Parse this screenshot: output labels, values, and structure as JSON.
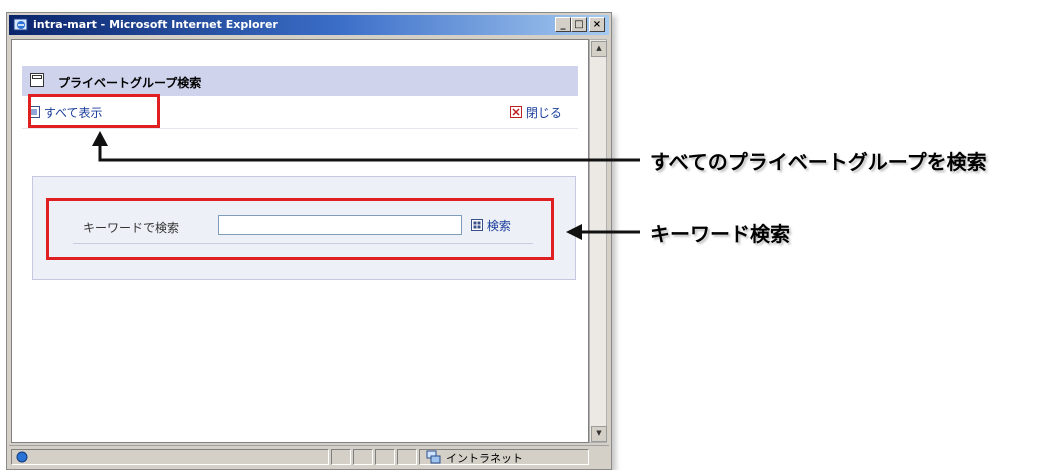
{
  "window": {
    "title": "intra-mart - Microsoft Internet Explorer",
    "min_glyph": "_",
    "max_glyph": "□",
    "close_glyph": "×"
  },
  "page": {
    "header_title": "プライベートグループ検索",
    "show_all_label": "すべて表示",
    "close_label": "閉じる"
  },
  "search": {
    "keyword_label": "キーワードで検索",
    "keyword_value": "",
    "button_label": "検索"
  },
  "statusbar": {
    "zone_label": "イントラネット"
  },
  "annotations": {
    "show_all": "すべてのプライベートグループを検索",
    "keyword": "キーワード検索"
  },
  "colors": {
    "highlight": "#e02020",
    "link": "#1a3d9c",
    "header_bg": "#cfd3ec"
  }
}
